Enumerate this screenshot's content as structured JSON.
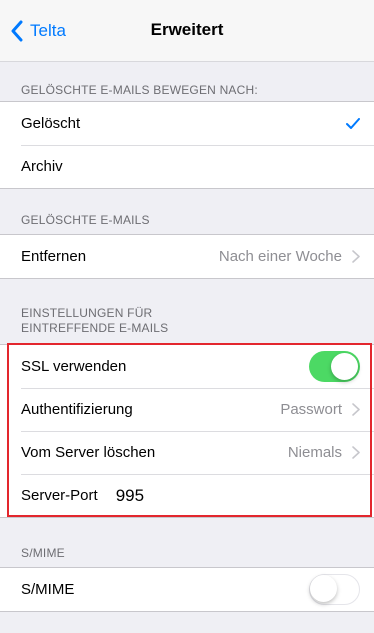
{
  "nav": {
    "back_label": "Telta",
    "title": "Erweitert"
  },
  "sections": {
    "move_deleted": {
      "header": "GELÖSCHTE E-MAILS BEWEGEN NACH:",
      "options": [
        {
          "label": "Gelöscht",
          "selected": true
        },
        {
          "label": "Archiv",
          "selected": false
        }
      ]
    },
    "deleted_mails": {
      "header": "GELÖSCHTE E-MAILS",
      "remove": {
        "label": "Entfernen",
        "value": "Nach einer Woche"
      }
    },
    "incoming": {
      "header_line1": "EINSTELLUNGEN FÜR",
      "header_line2": "EINTREFFENDE E-MAILS",
      "ssl": {
        "label": "SSL verwenden",
        "on": true
      },
      "auth": {
        "label": "Authentifizierung",
        "value": "Passwort"
      },
      "delete_from_server": {
        "label": "Vom Server löschen",
        "value": "Niemals"
      },
      "server_port": {
        "label": "Server-Port",
        "value": "995"
      }
    },
    "smime": {
      "header": "S/MIME",
      "toggle": {
        "label": "S/MIME",
        "on": false
      }
    }
  },
  "colors": {
    "accent": "#007aff",
    "toggle_on": "#4cd964",
    "highlight": "#e3262d"
  }
}
